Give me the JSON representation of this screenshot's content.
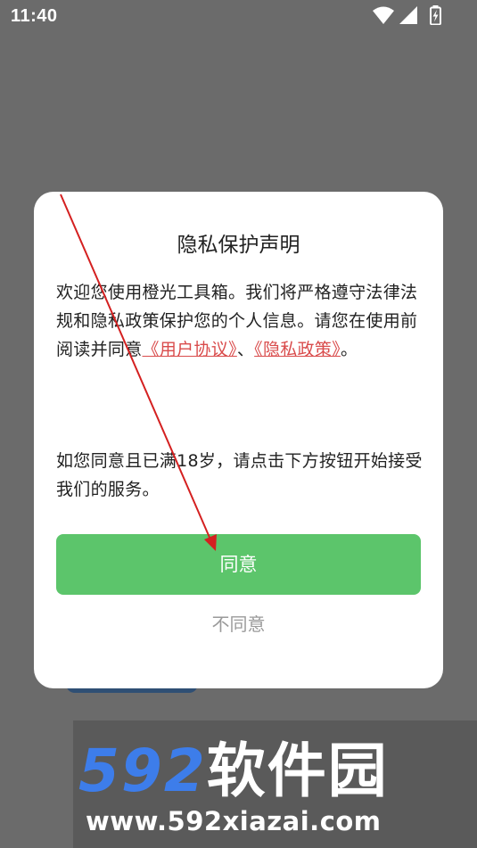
{
  "status_bar": {
    "time": "11:40",
    "icons": [
      "wifi-icon",
      "signal-icon",
      "battery-charging-icon"
    ]
  },
  "dialog": {
    "title": "隐私保护声明",
    "body_text": "欢迎您使用橙光工具箱。我们将严格遵守法律法规和隐私政策保护您的个人信息。请您在使用前阅读并同意",
    "user_agreement_link": "《用户协议》",
    "separator": "、",
    "privacy_policy_link": "《隐私政策》",
    "period": "。",
    "age_notice": "如您同意且已满18岁，请点击下方按钮开始接受我们的服务。",
    "agree_label": "同意",
    "disagree_label": "不同意"
  },
  "watermark": {
    "logo_number": "592",
    "logo_text": "软件园",
    "url": "www.592xiazai.com"
  },
  "colors": {
    "overlay": "#6b6b6b",
    "agree_button": "#5cc56b",
    "link": "#d94b4b",
    "annotation_arrow": "#d42020",
    "watermark_blue": "#3d7dea"
  }
}
